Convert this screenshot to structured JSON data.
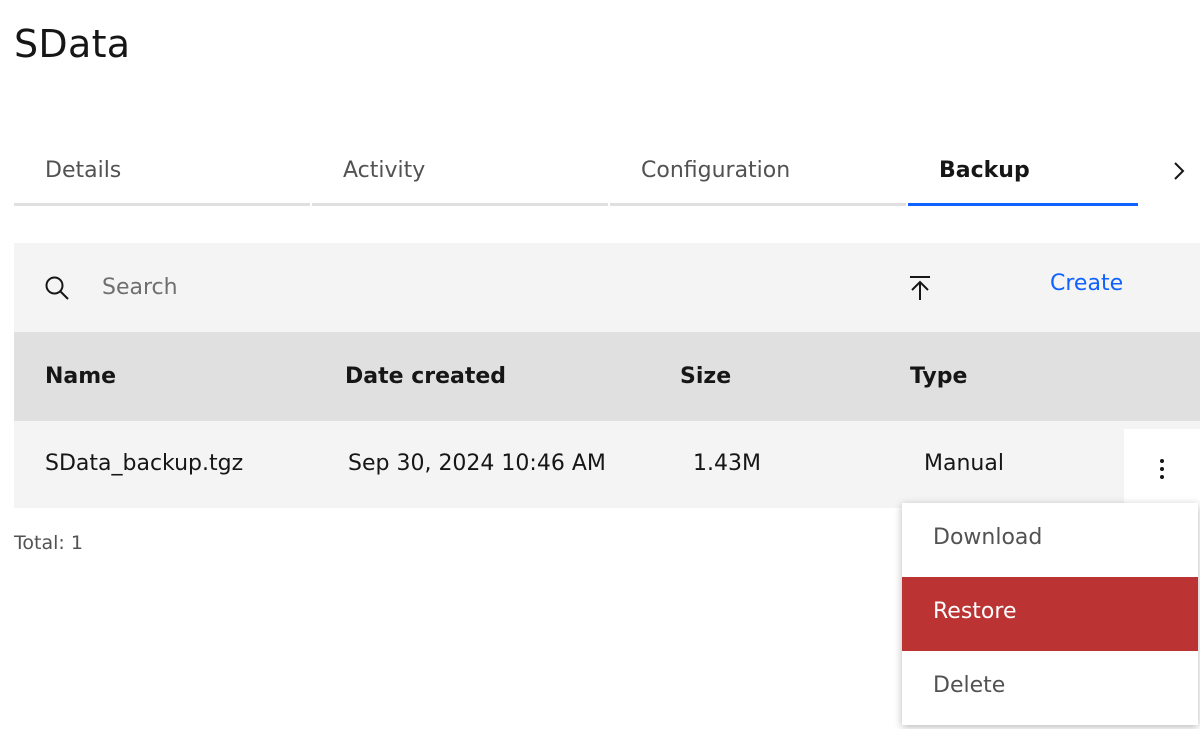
{
  "page": {
    "title": "SData"
  },
  "tabs": [
    {
      "label": "Details",
      "active": false
    },
    {
      "label": "Activity",
      "active": false
    },
    {
      "label": "Configuration",
      "active": false
    },
    {
      "label": "Backup",
      "active": true
    }
  ],
  "toolbar": {
    "search_placeholder": "Search",
    "create_label": "Create",
    "icons": {
      "search": "search-icon",
      "upload": "upload-icon",
      "next": "chevron-right-icon"
    }
  },
  "table": {
    "columns": [
      "Name",
      "Date created",
      "Size",
      "Type"
    ],
    "rows": [
      {
        "name": "SData_backup.tgz",
        "date_created": "Sep 30, 2024 10:46 AM",
        "size": "1.43M",
        "type": "Manual"
      }
    ]
  },
  "footer": {
    "total": "Total: 1"
  },
  "overflow_menu": {
    "items": [
      {
        "label": "Download",
        "highlighted": false
      },
      {
        "label": "Restore",
        "highlighted": true
      },
      {
        "label": "Delete",
        "highlighted": false
      }
    ]
  },
  "colors": {
    "accent": "#0f62fe",
    "danger_highlight": "#bb3333",
    "toolbar_bg": "#f4f4f4",
    "header_bg": "#e0e0e0"
  }
}
